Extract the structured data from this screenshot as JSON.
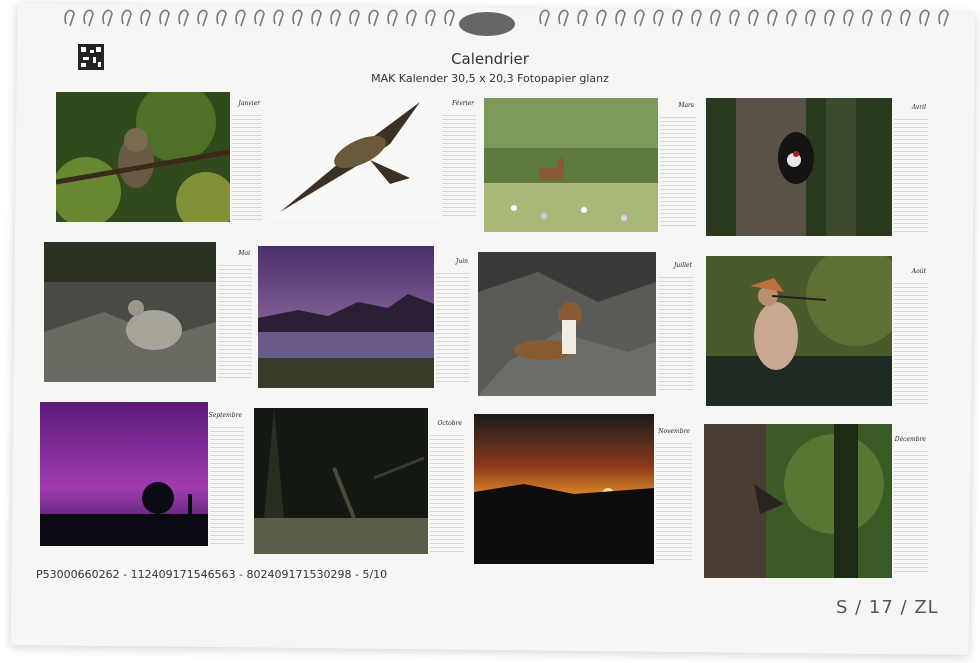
{
  "header": {
    "title": "Calendrier",
    "subtitle": "MAK Kalender 30,5 x 20,3 Fotopapier glanz"
  },
  "months": [
    {
      "name": "Janvier",
      "photo": "owl-in-foliage"
    },
    {
      "name": "Février",
      "photo": "bearded-vulture-flying"
    },
    {
      "name": "Mars",
      "photo": "chamois-in-meadow"
    },
    {
      "name": "Avril",
      "photo": "woodpecker-at-tree-hole"
    },
    {
      "name": "Mai",
      "photo": "ptarmigan-on-rocks"
    },
    {
      "name": "Juin",
      "photo": "purple-sky-mountain-lake"
    },
    {
      "name": "Juillet",
      "photo": "stoat-on-rocks"
    },
    {
      "name": "Août",
      "photo": "hoopoe"
    },
    {
      "name": "Septembre",
      "photo": "aurora-borealis"
    },
    {
      "name": "Octobre",
      "photo": "deer-in-dark-forest"
    },
    {
      "name": "Novembre",
      "photo": "sunset-over-mountains"
    },
    {
      "name": "Décembre",
      "photo": "woodpecker-on-trunk"
    }
  ],
  "footer": {
    "codes": "P53000660262 - 112409171546563 - 802409171530298 - 5/10",
    "id": "S / 17 / ZL"
  },
  "colors": {
    "paper": "#f6f6f4",
    "spiral": "#8a8a8a"
  }
}
